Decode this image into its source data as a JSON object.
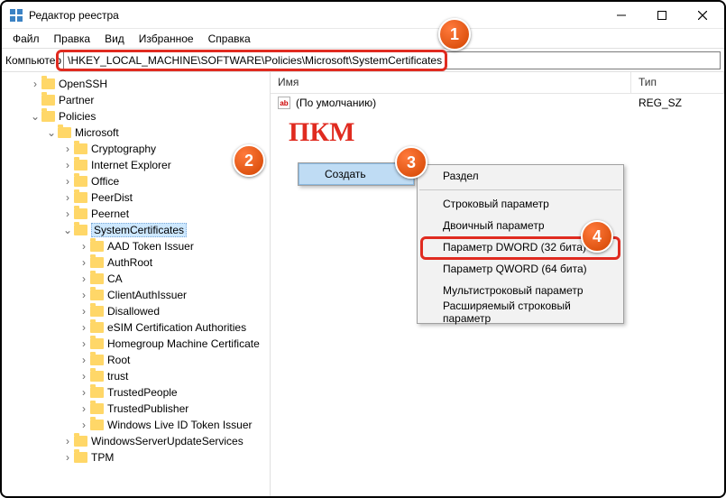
{
  "window": {
    "title": "Редактор реестра"
  },
  "menu": {
    "file": "Файл",
    "edit": "Правка",
    "view": "Вид",
    "favorites": "Избранное",
    "help": "Справка"
  },
  "address": {
    "label": "Компьютер",
    "value": "\\HKEY_LOCAL_MACHINE\\SOFTWARE\\Policies\\Microsoft\\SystemCertificates"
  },
  "columns": {
    "name": "Имя",
    "type": "Тип"
  },
  "default_row": {
    "name": "(По умолчанию)",
    "type": "REG_SZ"
  },
  "pkm_label": "ПКМ",
  "tree": {
    "openssh": "OpenSSH",
    "partner": "Partner",
    "policies": "Policies",
    "microsoft": "Microsoft",
    "cryptography": "Cryptography",
    "ie": "Internet Explorer",
    "office": "Office",
    "peerdist": "PeerDist",
    "peernet": "Peernet",
    "syscert": "SystemCertificates",
    "aad": "AAD Token Issuer",
    "authroot": "AuthRoot",
    "ca": "CA",
    "clientauth": "ClientAuthIssuer",
    "disallowed": "Disallowed",
    "esim": "eSIM Certification Authorities",
    "homegroup": "Homegroup Machine Certificate",
    "root": "Root",
    "trust": "trust",
    "trustedpeople": "TrustedPeople",
    "trustedpublisher": "TrustedPublisher",
    "winlive": "Windows Live ID Token Issuer",
    "wsus": "WindowsServerUpdateServices",
    "tpm": "TPM"
  },
  "ctx1": {
    "create": "Создать"
  },
  "ctx2": {
    "key": "Раздел",
    "string": "Строковый параметр",
    "binary": "Двоичный параметр",
    "dword": "Параметр DWORD (32 бита)",
    "qword": "Параметр QWORD (64 бита)",
    "multistring": "Мультистроковый параметр",
    "expandstring": "Расширяемый строковый параметр"
  },
  "badges": {
    "b1": "1",
    "b2": "2",
    "b3": "3",
    "b4": "4"
  }
}
